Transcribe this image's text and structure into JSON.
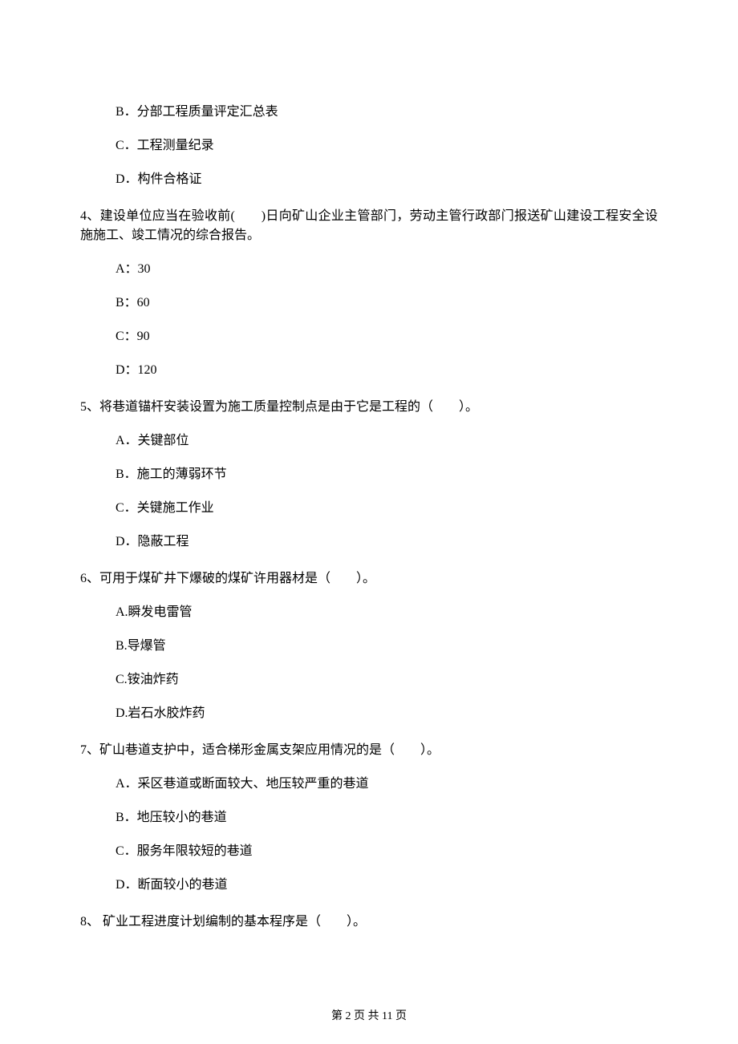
{
  "options_top": {
    "b": "B．分部工程质量评定汇总表",
    "c": "C．工程测量纪录",
    "d": "D．构件合格证"
  },
  "q4": {
    "text": "4、建设单位应当在验收前(　　)日向矿山企业主管部门，劳动主管行政部门报送矿山建设工程安全设施施工、竣工情况的综合报告。",
    "a": "A：30",
    "b": "B：60",
    "c": "C：90",
    "d": "D：120"
  },
  "q5": {
    "text": "5、将巷道锚杆安装设置为施工质量控制点是由于它是工程的（　　）。",
    "a": "A．关键部位",
    "b": "B．施工的薄弱环节",
    "c": "C．关键施工作业",
    "d": "D．隐蔽工程"
  },
  "q6": {
    "text": "6、可用于煤矿井下爆破的煤矿许用器材是（　　）。",
    "a": "A.瞬发电雷管",
    "b": "B.导爆管",
    "c": "C.铵油炸药",
    "d": "D.岩石水胶炸药"
  },
  "q7": {
    "text": "7、矿山巷道支护中，适合梯形金属支架应用情况的是（　　）。",
    "a": "A．采区巷道或断面较大、地压较严重的巷道",
    "b": "B．地压较小的巷道",
    "c": "C．服务年限较短的巷道",
    "d": "D．断面较小的巷道"
  },
  "q8": {
    "text": "8、 矿业工程进度计划编制的基本程序是（　　）。"
  },
  "footer": "第 2 页 共 11 页"
}
